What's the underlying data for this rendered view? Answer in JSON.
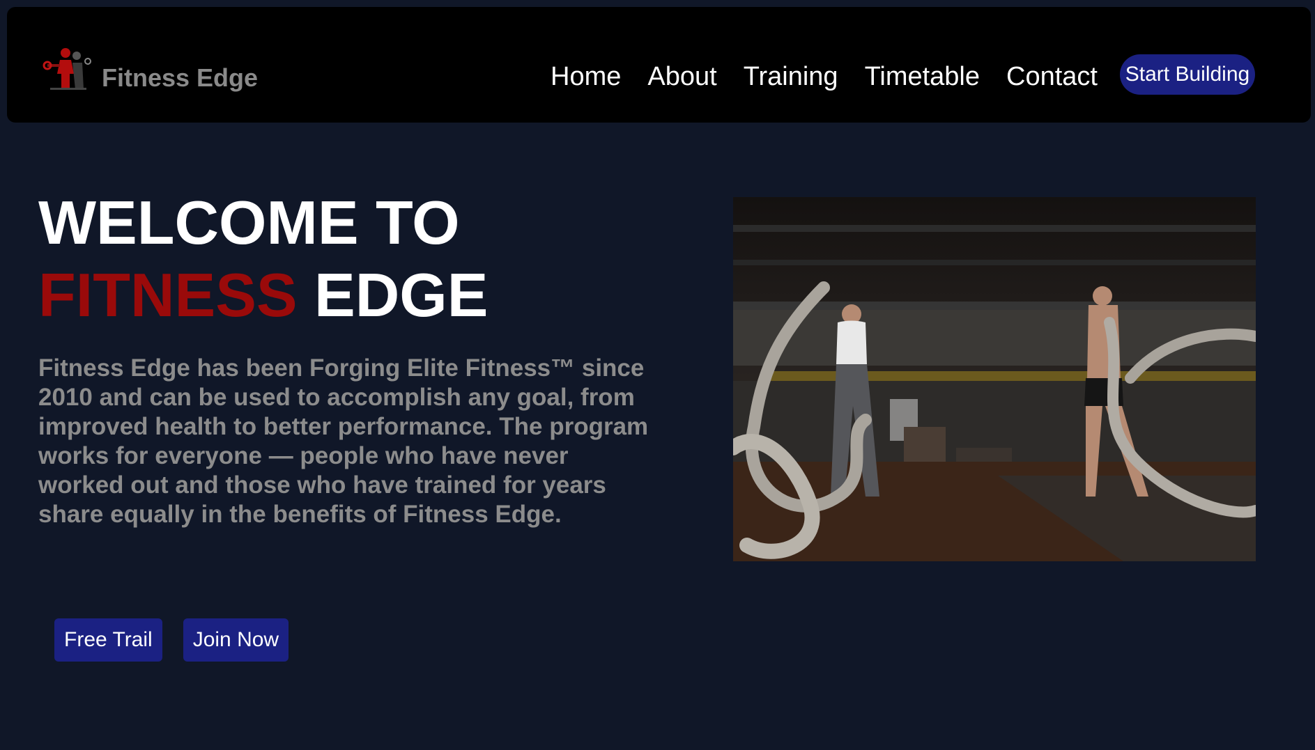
{
  "brand": {
    "name": "Fitness Edge",
    "logo_icon": "dumbbell-figure-logo-icon"
  },
  "nav": {
    "links": [
      "Home",
      "About",
      "Training",
      "Timetable",
      "Contact"
    ],
    "cta_label": "Start Building"
  },
  "hero": {
    "title_line1": "WELCOME TO",
    "title_accent": "FITNESS",
    "title_rest": " EDGE",
    "description": "Fitness Edge has been Forging Elite Fitness™ since 2010 and can be used to accomplish any goal, from improved health to better performance. The program works for everyone — people who have never worked out and those who have trained for years share equally in the benefits of Fitness Edge.",
    "buttons": {
      "free_trail": "Free Trail",
      "join_now": "Join Now"
    }
  },
  "colors": {
    "background": "#101728",
    "navbar": "#000000",
    "accent_red": "#9a0a0a",
    "button_blue": "#1b2183",
    "muted_text": "#8c8c8c"
  }
}
